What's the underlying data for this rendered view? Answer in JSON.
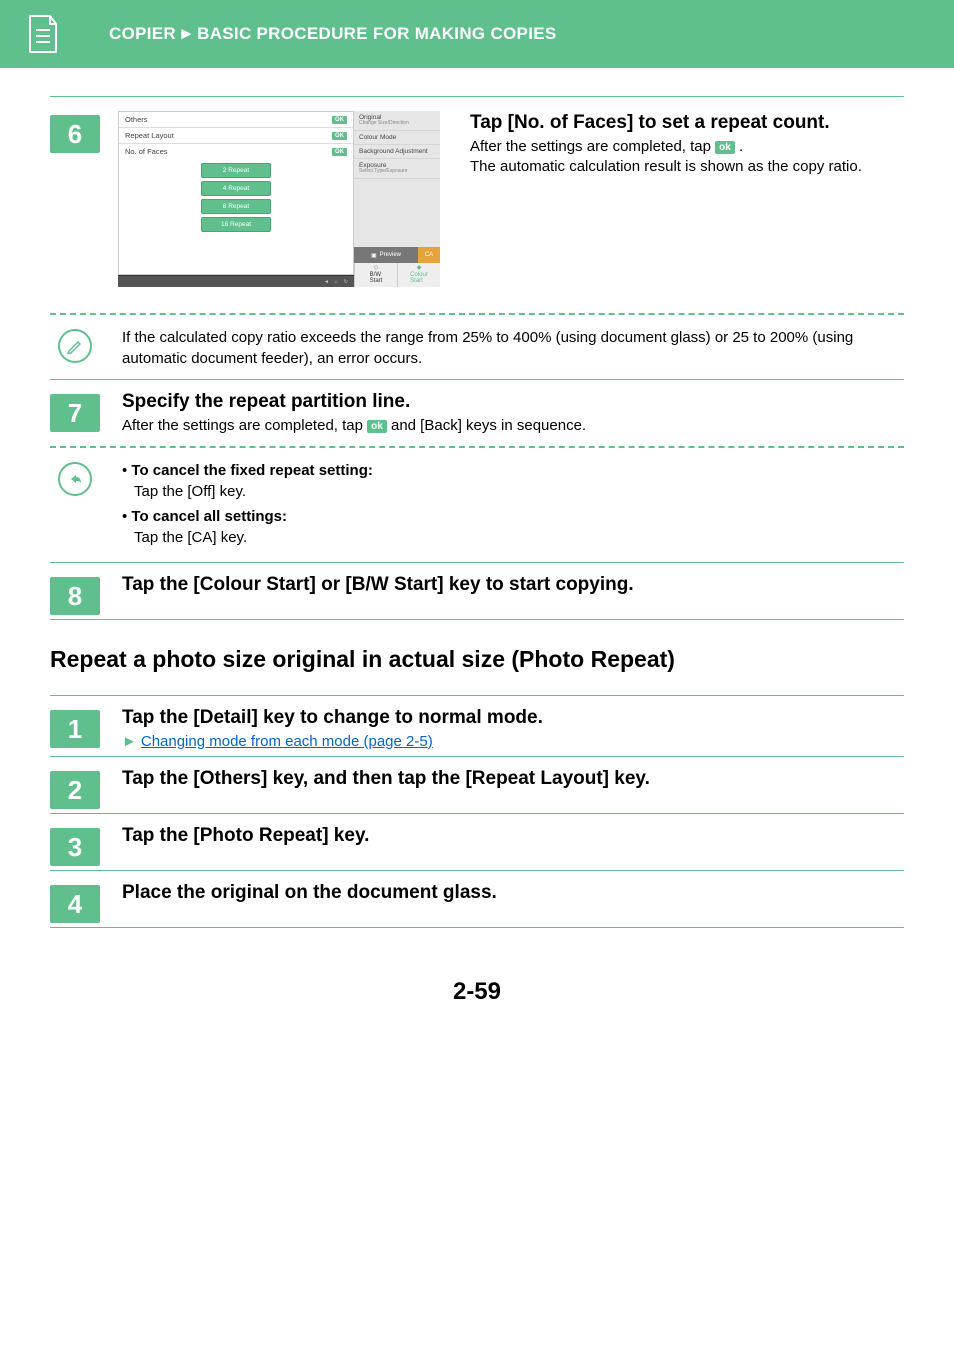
{
  "header": {
    "section": "COPIER",
    "subsection": "BASIC PROCEDURE FOR MAKING COPIES"
  },
  "step6": {
    "num": "6",
    "title": "Tap [No. of Faces] to set a repeat count.",
    "line1_pre": "After the settings are completed, tap ",
    "ok": "ok",
    "line1_post": " .",
    "line2": "The automatic calculation result is shown as the copy ratio.",
    "mock": {
      "others": "Others",
      "repeat_layout": "Repeat Layout",
      "no_of_faces": "No. of Faces",
      "ok": "OK",
      "buttons": [
        "2 Repeat",
        "4 Repeat",
        "8 Repeat",
        "16 Repeat"
      ],
      "side": {
        "original": "Original",
        "original_sub": "Change Size/Direction",
        "colour_mode": "Colour Mode",
        "bg": "Background Adjustment",
        "exposure": "Exposure",
        "exposure_sub": "Select Type/Exposure"
      },
      "preview": "Preview",
      "ca": "CA",
      "bw": "B/W\nStart",
      "colour": "Colour\nStart"
    }
  },
  "warn1": {
    "text": "If the calculated copy ratio exceeds the range from 25% to 400% (using document glass) or 25 to 200% (using automatic document feeder), an error occurs."
  },
  "step7": {
    "num": "7",
    "title": "Specify the repeat partition line.",
    "text_pre": "After the settings are completed, tap ",
    "ok": "ok",
    "text_post": " and [Back] keys in sequence."
  },
  "cancel_note": {
    "item1_label": "To cancel the fixed repeat setting:",
    "item1_text": "Tap the [Off] key.",
    "item2_label": "To cancel all settings:",
    "item2_text": "Tap the [CA] key."
  },
  "step8": {
    "num": "8",
    "title": "Tap the [Colour Start] or [B/W Start] key to start copying."
  },
  "section2": {
    "heading": "Repeat a photo size original in actual size (Photo Repeat)"
  },
  "step_a1": {
    "num": "1",
    "title": "Tap the [Detail] key to change to normal mode.",
    "link": "Changing mode from each mode (page 2-5)"
  },
  "step_a2": {
    "num": "2",
    "title": "Tap the [Others] key, and then tap the [Repeat Layout] key."
  },
  "step_a3": {
    "num": "3",
    "title": "Tap the [Photo Repeat] key."
  },
  "step_a4": {
    "num": "4",
    "title": "Place the original on the document glass."
  },
  "page_number": "2-59"
}
